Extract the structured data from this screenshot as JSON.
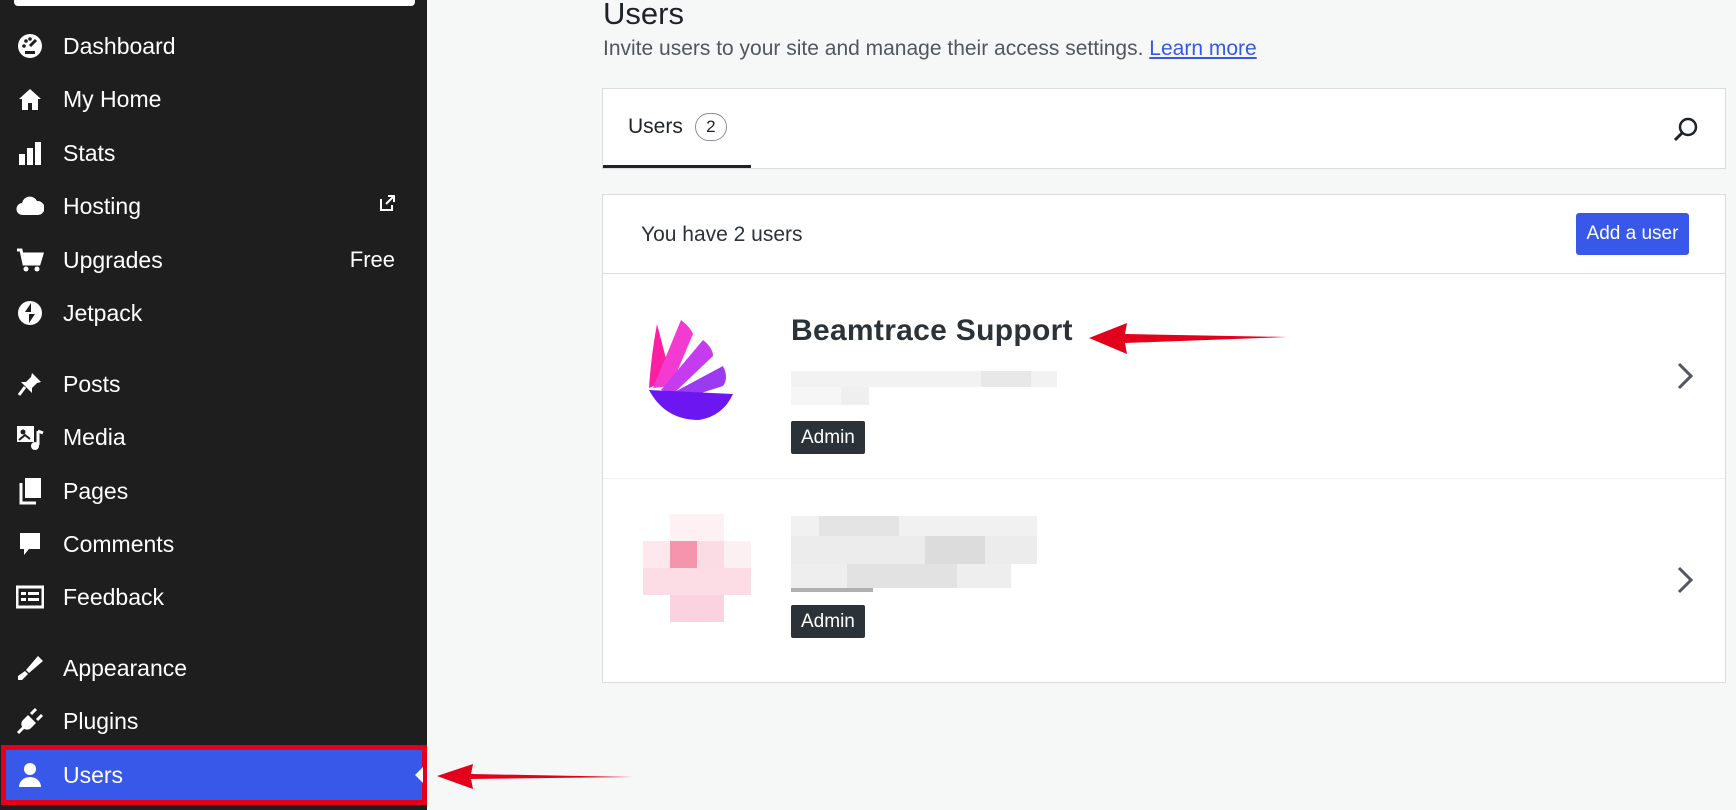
{
  "sidebar": {
    "items": [
      {
        "label": "Dashboard",
        "icon": "dashboard-icon"
      },
      {
        "label": "My Home",
        "icon": "home-icon"
      },
      {
        "label": "Stats",
        "icon": "stats-icon"
      },
      {
        "label": "Hosting",
        "icon": "cloud-icon",
        "external": true
      },
      {
        "label": "Upgrades",
        "icon": "cart-icon",
        "badge": "Free"
      },
      {
        "label": "Jetpack",
        "icon": "jetpack-icon"
      },
      {
        "label": "Posts",
        "icon": "pin-icon"
      },
      {
        "label": "Media",
        "icon": "media-icon"
      },
      {
        "label": "Pages",
        "icon": "pages-icon"
      },
      {
        "label": "Comments",
        "icon": "comment-icon"
      },
      {
        "label": "Feedback",
        "icon": "feedback-icon"
      },
      {
        "label": "Appearance",
        "icon": "brush-icon"
      },
      {
        "label": "Plugins",
        "icon": "plug-icon"
      },
      {
        "label": "Users",
        "icon": "user-icon",
        "active": true
      }
    ]
  },
  "header": {
    "title": "Users",
    "subtitle": "Invite users to your site and manage their access settings.",
    "learn_more": "Learn more"
  },
  "tabs": [
    {
      "label": "Users",
      "count": "2"
    }
  ],
  "users_card": {
    "summary": "You have 2 users",
    "add_user_label": "Add a user",
    "users": [
      {
        "name": "Beamtrace Support",
        "role": "Admin"
      },
      {
        "name": "",
        "role": "Admin"
      }
    ]
  },
  "colors": {
    "sidebar_bg": "#1e1e1e",
    "accent": "#3858e9",
    "annotation_red": "#e2001a"
  }
}
